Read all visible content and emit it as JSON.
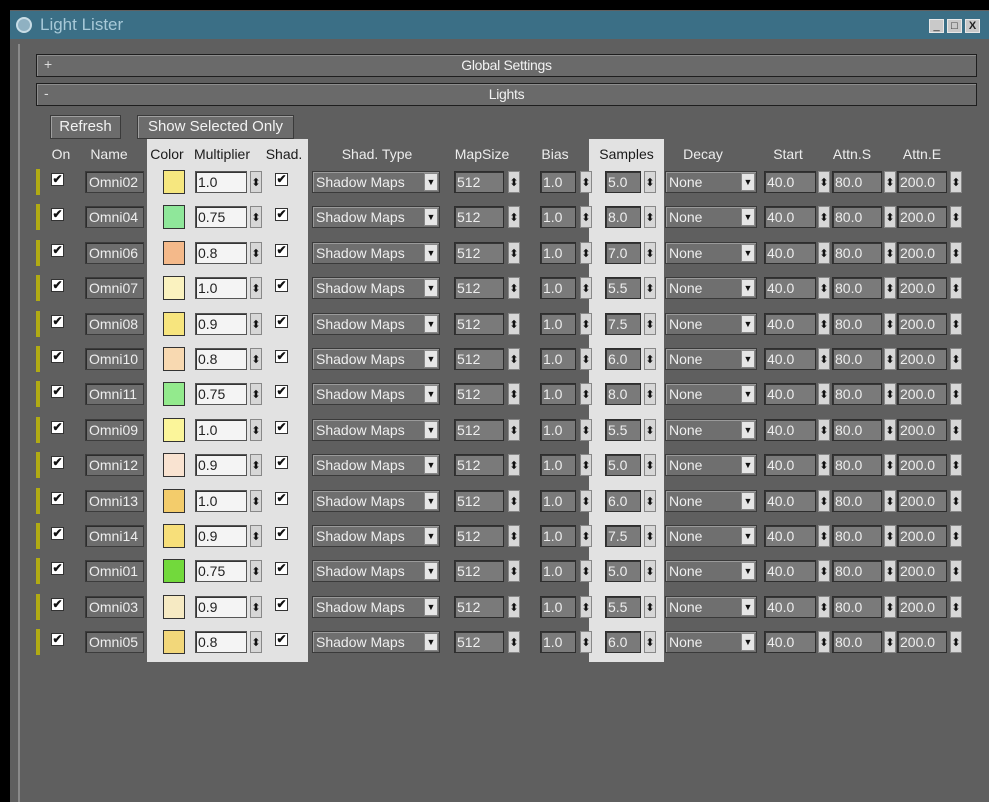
{
  "window": {
    "title": "Light Lister",
    "controls": [
      "_",
      "□",
      "X"
    ]
  },
  "rollouts": {
    "global": {
      "sign": "+",
      "title": "Global Settings"
    },
    "lights": {
      "sign": "-",
      "title": "Lights"
    }
  },
  "toolbar": {
    "refresh_label": "Refresh",
    "show_selected_label": "Show Selected Only"
  },
  "columns": {
    "on": "On",
    "name": "Name",
    "color": "Color",
    "multiplier": "Multiplier",
    "shad": "Shad.",
    "shad_type": "Shad. Type",
    "mapsize": "MapSize",
    "bias": "Bias",
    "samples": "Samples",
    "decay": "Decay",
    "start": "Start",
    "attn_s": "Attn.S",
    "attn_e": "Attn.E"
  },
  "lights": [
    {
      "on": "✔",
      "name": "Omni02",
      "color": "#f6e77f",
      "multiplier": "1.0",
      "shad": "✔",
      "shad_type": "Shadow Maps",
      "mapsize": "512",
      "bias": "1.0",
      "samples": "5.0",
      "decay": "None",
      "start": "40.0",
      "attn_s": "80.0",
      "attn_e": "200.0"
    },
    {
      "on": "✔",
      "name": "Omni04",
      "color": "#8fe79a",
      "multiplier": "0.75",
      "shad": "✔",
      "shad_type": "Shadow Maps",
      "mapsize": "512",
      "bias": "1.0",
      "samples": "8.0",
      "decay": "None",
      "start": "40.0",
      "attn_s": "80.0",
      "attn_e": "200.0"
    },
    {
      "on": "✔",
      "name": "Omni06",
      "color": "#f4b98a",
      "multiplier": "0.8",
      "shad": "✔",
      "shad_type": "Shadow Maps",
      "mapsize": "512",
      "bias": "1.0",
      "samples": "7.0",
      "decay": "None",
      "start": "40.0",
      "attn_s": "80.0",
      "attn_e": "200.0"
    },
    {
      "on": "✔",
      "name": "Omni07",
      "color": "#faf2bf",
      "multiplier": "1.0",
      "shad": "✔",
      "shad_type": "Shadow Maps",
      "mapsize": "512",
      "bias": "1.0",
      "samples": "5.5",
      "decay": "None",
      "start": "40.0",
      "attn_s": "80.0",
      "attn_e": "200.0"
    },
    {
      "on": "✔",
      "name": "Omni08",
      "color": "#f7e57e",
      "multiplier": "0.9",
      "shad": "✔",
      "shad_type": "Shadow Maps",
      "mapsize": "512",
      "bias": "1.0",
      "samples": "7.5",
      "decay": "None",
      "start": "40.0",
      "attn_s": "80.0",
      "attn_e": "200.0"
    },
    {
      "on": "✔",
      "name": "Omni10",
      "color": "#f8d9b1",
      "multiplier": "0.8",
      "shad": "✔",
      "shad_type": "Shadow Maps",
      "mapsize": "512",
      "bias": "1.0",
      "samples": "6.0",
      "decay": "None",
      "start": "40.0",
      "attn_s": "80.0",
      "attn_e": "200.0"
    },
    {
      "on": "✔",
      "name": "Omni11",
      "color": "#93ea8d",
      "multiplier": "0.75",
      "shad": "✔",
      "shad_type": "Shadow Maps",
      "mapsize": "512",
      "bias": "1.0",
      "samples": "8.0",
      "decay": "None",
      "start": "40.0",
      "attn_s": "80.0",
      "attn_e": "200.0"
    },
    {
      "on": "✔",
      "name": "Omni09",
      "color": "#fbf59a",
      "multiplier": "1.0",
      "shad": "✔",
      "shad_type": "Shadow Maps",
      "mapsize": "512",
      "bias": "1.0",
      "samples": "5.5",
      "decay": "None",
      "start": "40.0",
      "attn_s": "80.0",
      "attn_e": "200.0"
    },
    {
      "on": "✔",
      "name": "Omni12",
      "color": "#f9e3d1",
      "multiplier": "0.9",
      "shad": "✔",
      "shad_type": "Shadow Maps",
      "mapsize": "512",
      "bias": "1.0",
      "samples": "5.0",
      "decay": "None",
      "start": "40.0",
      "attn_s": "80.0",
      "attn_e": "200.0"
    },
    {
      "on": "✔",
      "name": "Omni13",
      "color": "#f3cc6b",
      "multiplier": "1.0",
      "shad": "✔",
      "shad_type": "Shadow Maps",
      "mapsize": "512",
      "bias": "1.0",
      "samples": "6.0",
      "decay": "None",
      "start": "40.0",
      "attn_s": "80.0",
      "attn_e": "200.0"
    },
    {
      "on": "✔",
      "name": "Omni14",
      "color": "#f7df7a",
      "multiplier": "0.9",
      "shad": "✔",
      "shad_type": "Shadow Maps",
      "mapsize": "512",
      "bias": "1.0",
      "samples": "7.5",
      "decay": "None",
      "start": "40.0",
      "attn_s": "80.0",
      "attn_e": "200.0"
    },
    {
      "on": "✔",
      "name": "Omni01",
      "color": "#72d93c",
      "multiplier": "0.75",
      "shad": "✔",
      "shad_type": "Shadow Maps",
      "mapsize": "512",
      "bias": "1.0",
      "samples": "5.0",
      "decay": "None",
      "start": "40.0",
      "attn_s": "80.0",
      "attn_e": "200.0"
    },
    {
      "on": "✔",
      "name": "Omni03",
      "color": "#f6eac3",
      "multiplier": "0.9",
      "shad": "✔",
      "shad_type": "Shadow Maps",
      "mapsize": "512",
      "bias": "1.0",
      "samples": "5.5",
      "decay": "None",
      "start": "40.0",
      "attn_s": "80.0",
      "attn_e": "200.0"
    },
    {
      "on": "✔",
      "name": "Omni05",
      "color": "#f2d77a",
      "multiplier": "0.8",
      "shad": "✔",
      "shad_type": "Shadow Maps",
      "mapsize": "512",
      "bias": "1.0",
      "samples": "6.0",
      "decay": "None",
      "start": "40.0",
      "attn_s": "80.0",
      "attn_e": "200.0"
    }
  ],
  "glyphs": {
    "spinner": "⬍",
    "dropdown": "▼"
  },
  "colors": {
    "titlebar": "#3b6f86",
    "panel": "#5f5f5f",
    "highlight": "#e2e2e2",
    "light_marker": "#b1ab13"
  }
}
